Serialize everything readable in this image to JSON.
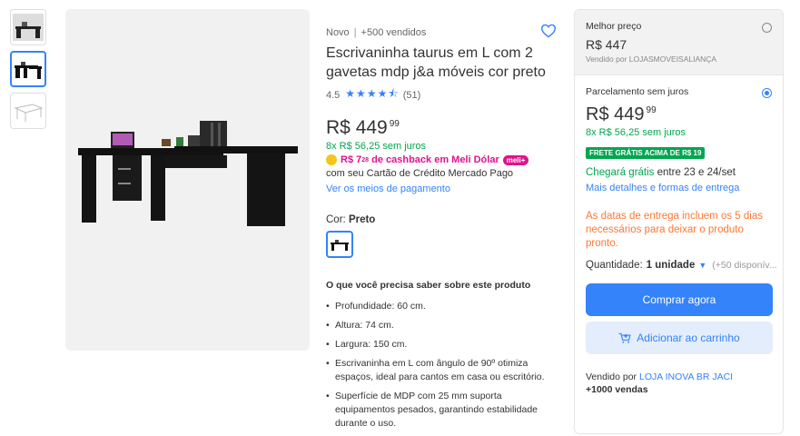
{
  "gallery": {
    "thumbnails": [
      "desk-thumb-1",
      "desk-thumb-2",
      "desk-thumb-3"
    ],
    "active_index": 1
  },
  "product": {
    "condition": "Novo",
    "sold": "+500 vendidos",
    "title": "Escrivaninha taurus em L com 2 gavetas mdp j&a móveis cor preto",
    "rating": "4.5",
    "rating_value": 4.5,
    "reviews": "(51)",
    "currency": "R$",
    "price_int": "449",
    "price_cents": "99",
    "installments": "8x R$ 56,25 sem juros",
    "cashback_amount": "R$ 7",
    "cashback_cents": "28",
    "cashback_text": "de cashback em Meli Dólar",
    "meli_badge": "meli+",
    "card_text": "com seu Cartão de Crédito Mercado Pago",
    "payment_link": "Ver os meios de pagamento",
    "color_label": "Cor:",
    "color_value": "Preto",
    "know_title": "O que você precisa saber sobre este produto",
    "features": [
      "Profundidade: 60 cm.",
      "Altura: 74 cm.",
      "Largura: 150 cm.",
      "Escrivaninha em L com ângulo de 90º otimiza espaços, ideal para cantos em casa ou escritório.",
      "Superfície de MDP com 25 mm suporta equipamentos pesados, garantindo estabilidade durante o uso."
    ]
  },
  "buy_box": {
    "option1": {
      "label": "Melhor preço",
      "price": "R$ 447",
      "seller": "Vendido por LOJASMOVEISALIANÇA"
    },
    "option2": {
      "label": "Parcelamento sem juros",
      "currency": "R$",
      "price_int": "449",
      "price_cents": "99",
      "installments": "8x R$ 56,25 sem juros",
      "free_badge": "FRETE GRÁTIS ACIMA DE R$ 19",
      "delivery_green": "Chegará grátis",
      "delivery_rest": " entre 23 e 24/set",
      "delivery_link": "Mais detalhes e formas de entrega",
      "notice": "As datas de entrega incluem os 5 dias necessários para deixar o produto pronto.",
      "qty_label": "Quantidade:",
      "qty_value": "1 unidade",
      "qty_available": "(+50 disponív..."
    },
    "buy_now": "Comprar agora",
    "add_cart": "Adicionar ao carrinho",
    "seller_prefix": "Vendido por",
    "seller_name": "LOJA INOVA BR JACI",
    "seller_sales": "+1000 vendas"
  },
  "colors": {
    "accent": "#3483fa",
    "green": "#00a650",
    "orange": "#ff7733",
    "pink": "#e0138c"
  },
  "icons": [
    "heart-icon",
    "star-icon",
    "coin-icon",
    "chevron-down-icon",
    "cart-icon"
  ]
}
